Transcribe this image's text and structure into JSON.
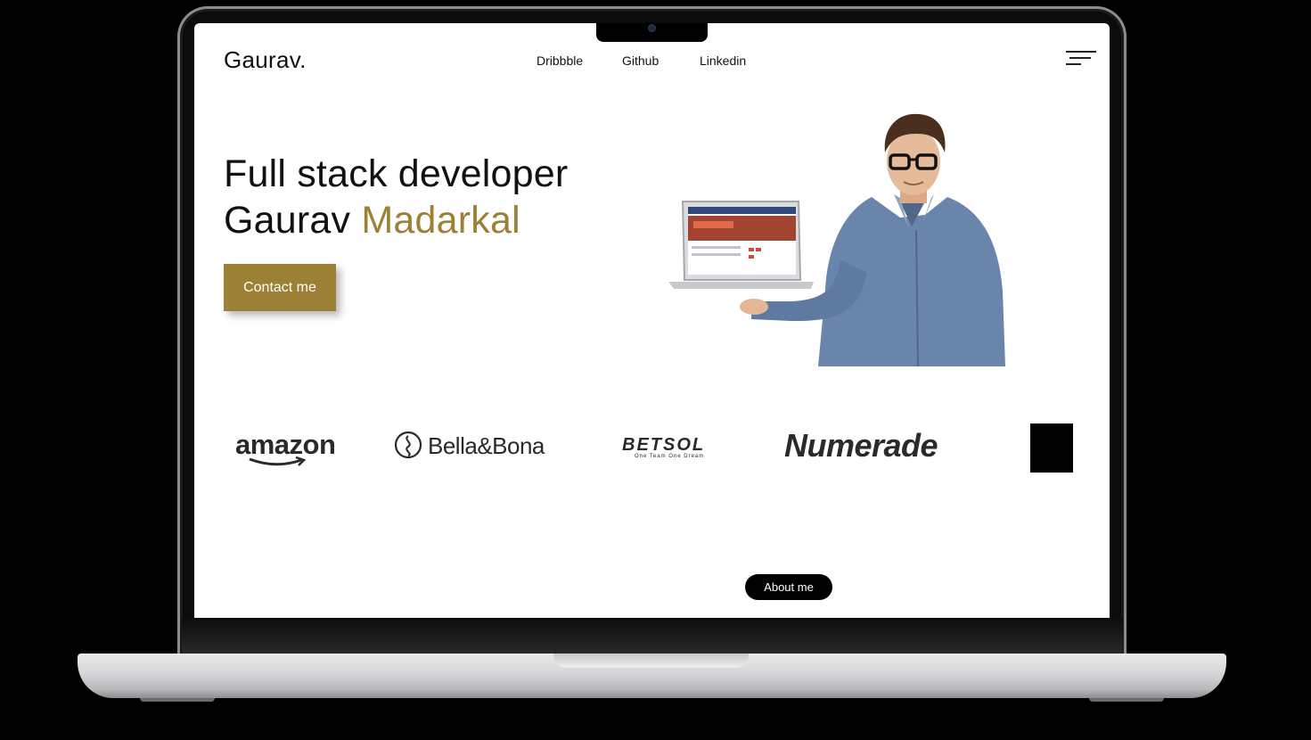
{
  "header": {
    "logo": "Gaurav.",
    "nav": [
      "Dribbble",
      "Github",
      "Linkedin"
    ]
  },
  "hero": {
    "line1": "Full stack developer",
    "line2_first": "Gaurav",
    "line2_accent": "Madarkal",
    "cta_label": "Contact me",
    "image": "developer-holding-laptop-photo"
  },
  "clients": {
    "logos": [
      "amazon",
      "Bella&Bona",
      "BETSOL",
      "Numerade"
    ],
    "betsol_tagline": "One Team One Dream"
  },
  "footer": {
    "about_label": "About me"
  },
  "colors": {
    "accent": "#9b8035",
    "background": "#ffffff",
    "text": "#111111",
    "device_frame": "#000000"
  }
}
